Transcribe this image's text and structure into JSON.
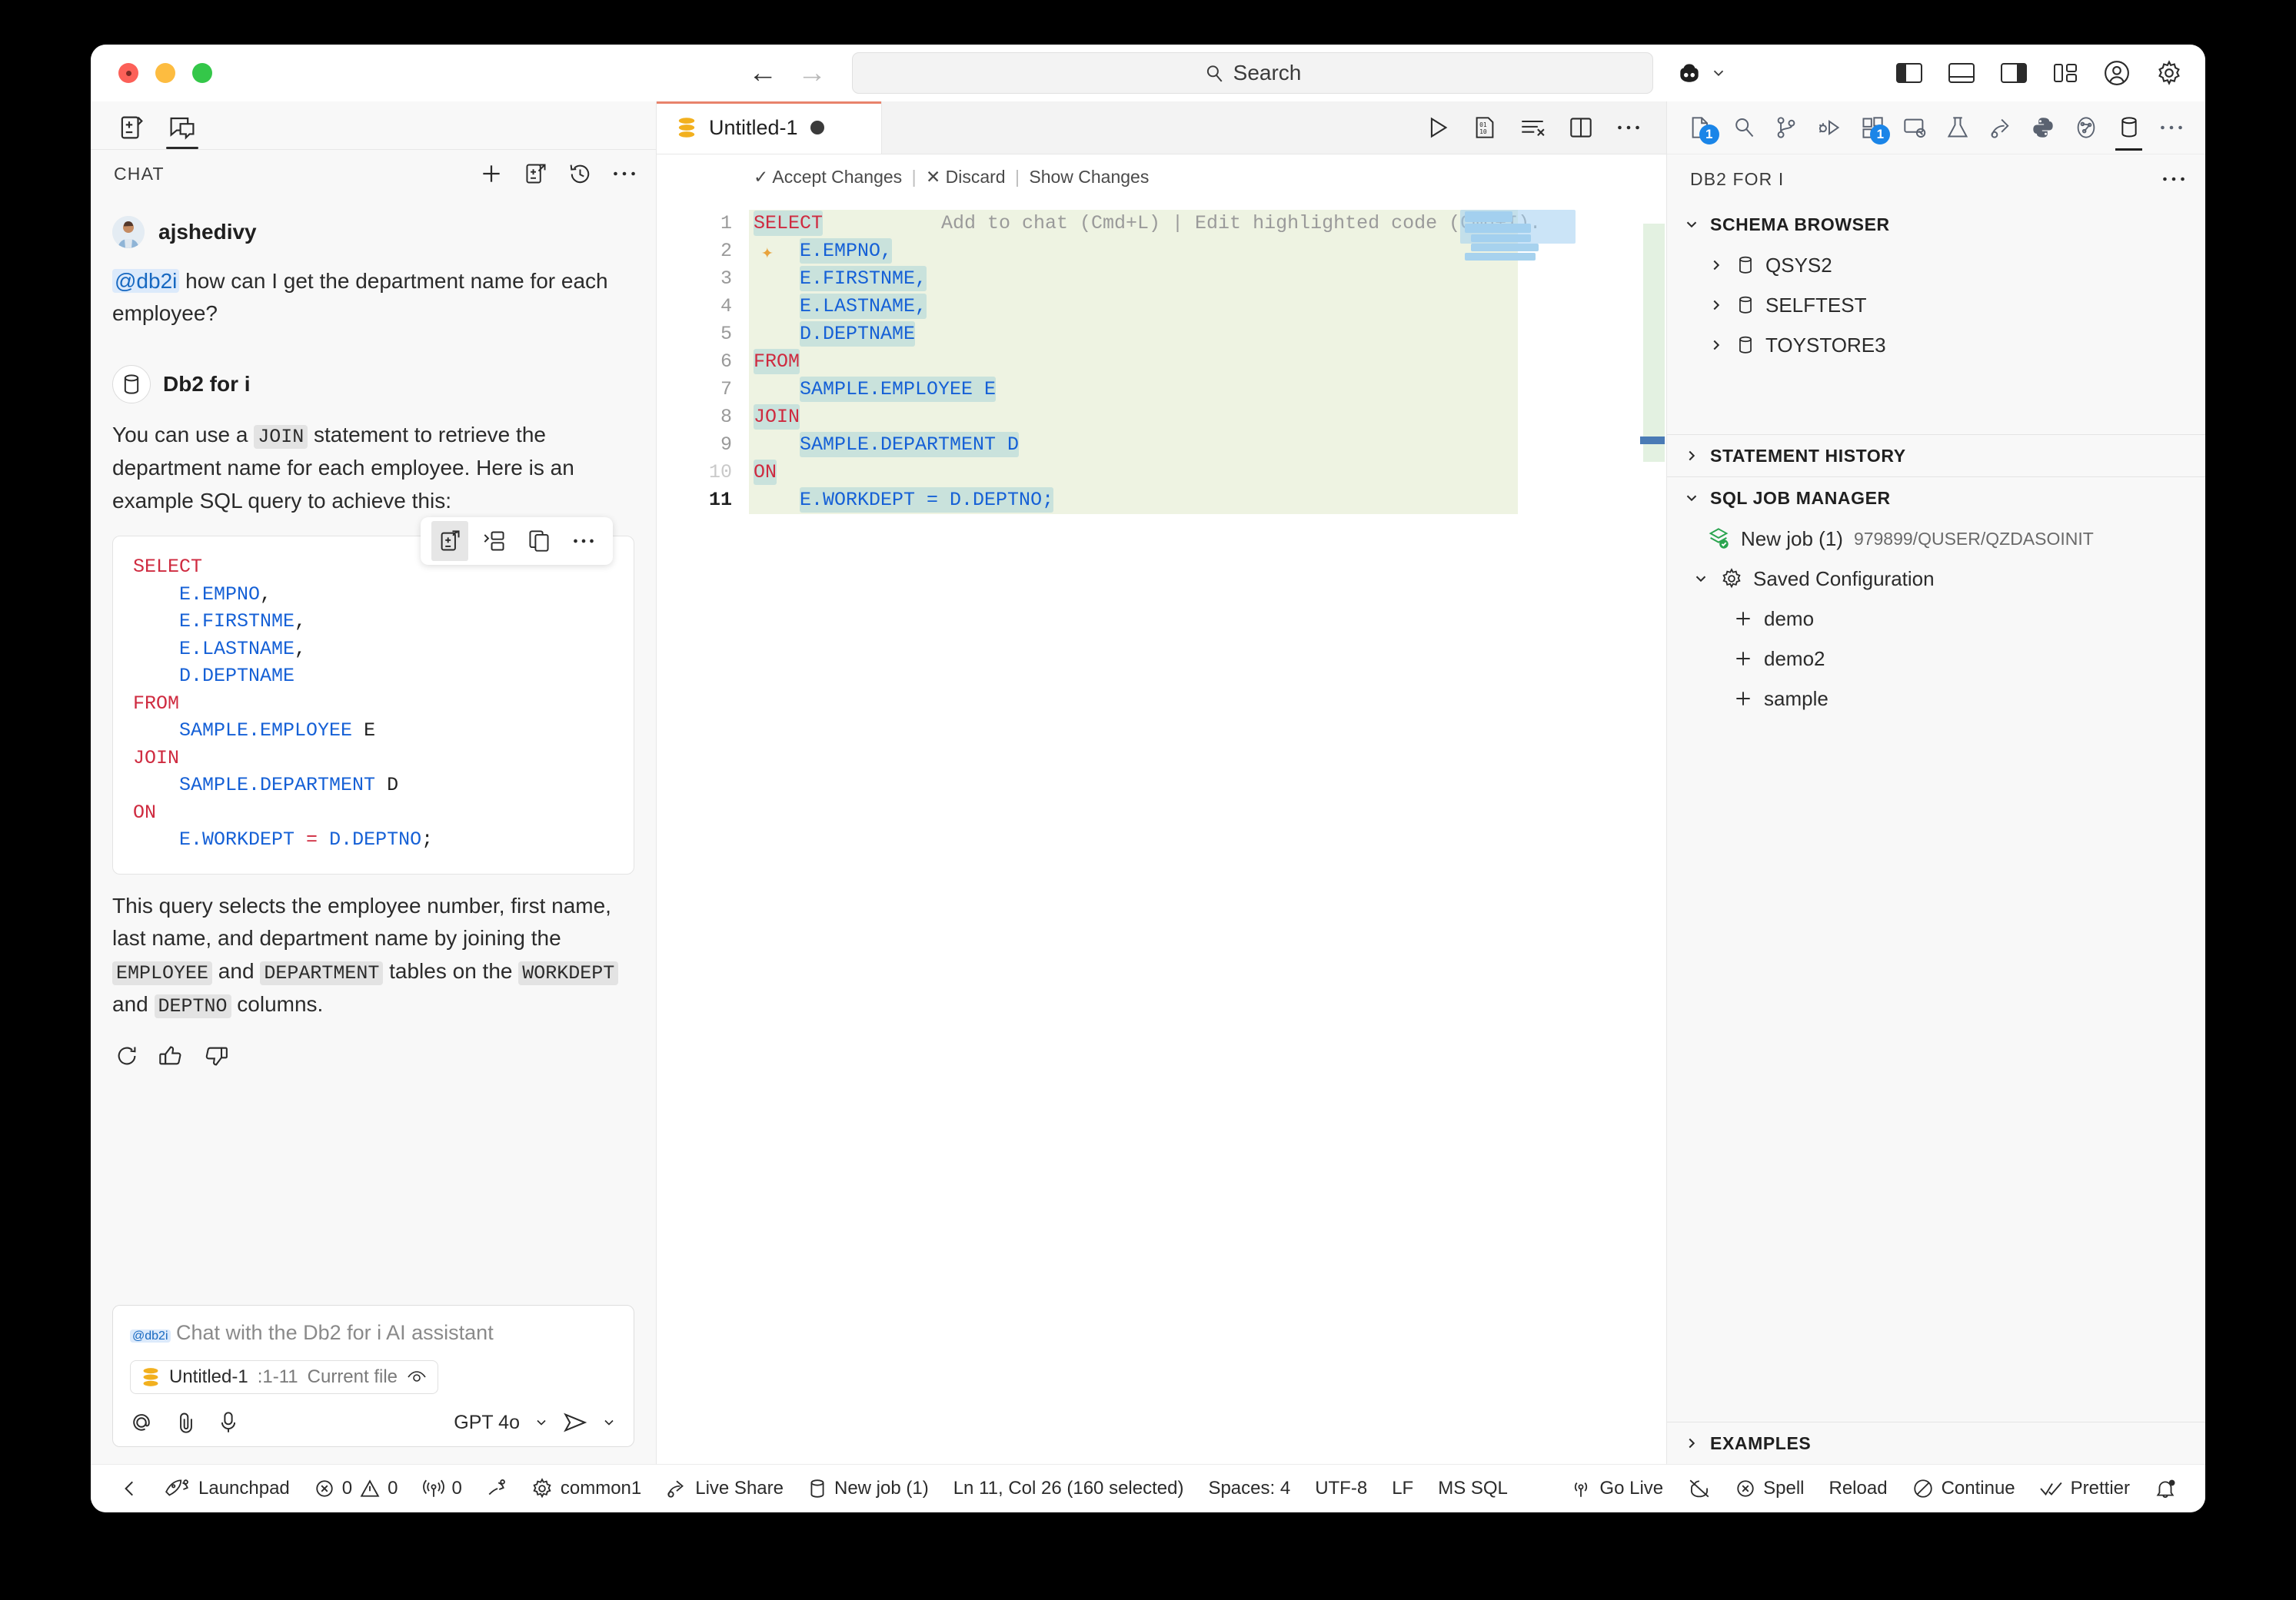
{
  "titlebar": {
    "search_placeholder": "Search",
    "icons": [
      "back-arrow",
      "forward-arrow",
      "search-icon",
      "copilot-icon",
      "chevron-down-icon",
      "layout-sidebar-left-icon",
      "layout-panel-icon",
      "layout-sidebar-right-icon",
      "layout-customize-icon",
      "account-icon",
      "gear-icon"
    ]
  },
  "chat_panel": {
    "tabs": [
      "source-control-tab",
      "chat-tab"
    ],
    "title": "CHAT",
    "actions": [
      "new-chat-icon",
      "open-editor-icon",
      "history-icon",
      "more-icon"
    ],
    "user": {
      "name": "ajshedivy",
      "mention": "@db2i",
      "question": " how can I get the department name for each employee?"
    },
    "bot": {
      "name": "Db2 for i",
      "intro_pre": "You can use a ",
      "intro_code": "JOIN",
      "intro_post": " statement to retrieve the department name for each employee. Here is an example SQL query to achieve this:",
      "code_toolbar": [
        "apply-to-editor-icon",
        "insert-at-cursor-icon",
        "copy-icon",
        "more-icon"
      ],
      "code_lines": [
        [
          {
            "t": "SELECT",
            "c": "kw"
          }
        ],
        [
          {
            "t": "    ",
            "c": "plain"
          },
          {
            "t": "E.EMPNO",
            "c": "ident"
          },
          {
            "t": ",",
            "c": "plain"
          }
        ],
        [
          {
            "t": "    ",
            "c": "plain"
          },
          {
            "t": "E.FIRSTNME",
            "c": "ident"
          },
          {
            "t": ",",
            "c": "plain"
          }
        ],
        [
          {
            "t": "    ",
            "c": "plain"
          },
          {
            "t": "E.LASTNAME",
            "c": "ident"
          },
          {
            "t": ",",
            "c": "plain"
          }
        ],
        [
          {
            "t": "    ",
            "c": "plain"
          },
          {
            "t": "D.DEPTNAME",
            "c": "ident"
          }
        ],
        [
          {
            "t": "FROM",
            "c": "kw"
          }
        ],
        [
          {
            "t": "    ",
            "c": "plain"
          },
          {
            "t": "SAMPLE.EMPLOYEE",
            "c": "ident"
          },
          {
            "t": " E",
            "c": "plain"
          }
        ],
        [
          {
            "t": "JOIN",
            "c": "kw"
          }
        ],
        [
          {
            "t": "    ",
            "c": "plain"
          },
          {
            "t": "SAMPLE.DEPARTMENT",
            "c": "ident"
          },
          {
            "t": " D",
            "c": "plain"
          }
        ],
        [
          {
            "t": "ON",
            "c": "kw"
          }
        ],
        [
          {
            "t": "    ",
            "c": "plain"
          },
          {
            "t": "E.WORKDEPT",
            "c": "ident"
          },
          {
            "t": " = ",
            "c": "op"
          },
          {
            "t": "D.DEPTNO",
            "c": "ident"
          },
          {
            "t": ";",
            "c": "plain"
          }
        ]
      ],
      "explain_1": "This query selects the employee number, first name, last name, and department name by joining the ",
      "explain_code_1": "EMPLOYEE",
      "explain_2": " and ",
      "explain_code_2": "DEPARTMENT",
      "explain_3": " tables on the ",
      "explain_code_3": "WORKDEPT",
      "explain_4": " and ",
      "explain_code_4": "DEPTNO",
      "explain_5": " columns.",
      "feedback_icons": [
        "regenerate-icon",
        "thumbs-up-icon",
        "thumbs-down-icon"
      ]
    },
    "input": {
      "mention": "@db2i",
      "placeholder": " Chat with the Db2 for i AI assistant",
      "context_file": "Untitled-1",
      "context_range": ":1-11",
      "context_label": "Current file",
      "context_eye_icon": "eye-icon",
      "left_icons": [
        "mention-icon",
        "attach-icon",
        "microphone-icon"
      ],
      "model": "GPT 4o",
      "send_icon": "send-icon"
    }
  },
  "editor": {
    "tab": {
      "title": "Untitled-1",
      "icon": "db2-file-icon",
      "dirty": true
    },
    "tab_actions": [
      "run-icon",
      "run-binary-icon",
      "format-clear-icon",
      "split-editor-icon",
      "more-icon"
    ],
    "inline_bar": {
      "accept": "Accept Changes",
      "discard": "Discard",
      "show": "Show Changes",
      "accept_icon": "check-icon",
      "discard_icon": "close-icon"
    },
    "ghost_hint": "Add to chat (Cmd+L) | Edit highlighted code (Cmd+I).",
    "line_numbers": [
      "1",
      "2",
      "3",
      "4",
      "5",
      "6",
      "7",
      "8",
      "9",
      "10",
      "11"
    ],
    "current_line": 11,
    "dim_lines": [
      10
    ],
    "code_lines": [
      [
        {
          "t": "SELECT",
          "c": "kw",
          "sel": true
        }
      ],
      [
        {
          "t": "    ",
          "c": "plain"
        },
        {
          "t": "E.EMPNO,",
          "c": "ident",
          "sel": true
        }
      ],
      [
        {
          "t": "    ",
          "c": "plain"
        },
        {
          "t": "E.FIRSTNME,",
          "c": "ident",
          "sel": true
        }
      ],
      [
        {
          "t": "    ",
          "c": "plain"
        },
        {
          "t": "E.LASTNAME,",
          "c": "ident",
          "sel": true
        }
      ],
      [
        {
          "t": "    ",
          "c": "plain"
        },
        {
          "t": "D.DEPTNAME",
          "c": "ident",
          "sel": true
        }
      ],
      [
        {
          "t": "FROM",
          "c": "kw",
          "sel": true
        }
      ],
      [
        {
          "t": "    ",
          "c": "plain"
        },
        {
          "t": "SAMPLE.EMPLOYEE E",
          "c": "ident",
          "sel": true
        }
      ],
      [
        {
          "t": "JOIN",
          "c": "kw",
          "sel": true
        }
      ],
      [
        {
          "t": "    ",
          "c": "plain"
        },
        {
          "t": "SAMPLE.DEPARTMENT D",
          "c": "ident",
          "sel": true
        }
      ],
      [
        {
          "t": "ON",
          "c": "kw",
          "sel": true
        }
      ],
      [
        {
          "t": "    ",
          "c": "plain"
        },
        {
          "t": "E.WORKDEPT = D.DEPTNO;",
          "c": "ident",
          "sel": true
        }
      ]
    ]
  },
  "right_sidebar": {
    "activity_icons": [
      {
        "name": "explorer-icon",
        "badge": "1"
      },
      {
        "name": "search-icon",
        "badge": null
      },
      {
        "name": "source-control-icon",
        "badge": null
      },
      {
        "name": "run-debug-icon",
        "badge": null
      },
      {
        "name": "extensions-icon",
        "badge": "1"
      },
      {
        "name": "remote-explorer-icon",
        "badge": null
      },
      {
        "name": "testing-icon",
        "badge": null
      },
      {
        "name": "live-share-icon",
        "badge": null
      },
      {
        "name": "python-icon",
        "badge": null
      },
      {
        "name": "graph-icon",
        "badge": null
      },
      {
        "name": "database-icon",
        "badge": null
      },
      {
        "name": "more-icon",
        "badge": null
      }
    ],
    "title": "DB2 FOR I",
    "more_icon": "more-icon",
    "schema_browser": {
      "label": "SCHEMA BROWSER",
      "expanded": true,
      "items": [
        {
          "label": "QSYS2",
          "icon": "database-icon"
        },
        {
          "label": "SELFTEST",
          "icon": "database-icon"
        },
        {
          "label": "TOYSTORE3",
          "icon": "database-icon"
        }
      ]
    },
    "statement_history": {
      "label": "STATEMENT HISTORY",
      "expanded": false
    },
    "sql_job_manager": {
      "label": "SQL JOB MANAGER",
      "expanded": true,
      "job": {
        "label": "New job (1)",
        "detail": "979899/QUSER/QZDASOINIT",
        "icon": "job-connected-icon"
      },
      "saved_config": {
        "label": "Saved Configuration",
        "icon": "gear-icon",
        "expanded": true
      },
      "configs": [
        {
          "label": "demo",
          "icon": "plus-icon"
        },
        {
          "label": "demo2",
          "icon": "plus-icon"
        },
        {
          "label": "sample",
          "icon": "plus-icon"
        }
      ]
    },
    "examples": {
      "label": "EXAMPLES",
      "expanded": false
    }
  },
  "statusbar": {
    "left": [
      {
        "name": "remote-indicator",
        "icon": "remote-icon",
        "label": ""
      },
      {
        "name": "launchpad",
        "icon": "rocket-icon",
        "label": "Launchpad"
      },
      {
        "name": "problems",
        "icon": "error-warning-icon",
        "label": "0  0"
      },
      {
        "name": "ports",
        "icon": "radio-tower-icon",
        "label": "0"
      },
      {
        "name": "remote-alt",
        "icon": "remote-icon",
        "label": ""
      },
      {
        "name": "connection",
        "icon": "gear-icon",
        "label": "common1"
      },
      {
        "name": "live-share",
        "icon": "live-share-icon",
        "label": "Live Share"
      },
      {
        "name": "sql-job",
        "icon": "database-icon",
        "label": "New job (1)"
      },
      {
        "name": "cursor-position",
        "icon": "",
        "label": "Ln 11, Col 26 (160 selected)"
      },
      {
        "name": "indentation",
        "icon": "",
        "label": "Spaces: 4"
      },
      {
        "name": "encoding",
        "icon": "",
        "label": "UTF-8"
      },
      {
        "name": "eol",
        "icon": "",
        "label": "LF"
      },
      {
        "name": "language-mode",
        "icon": "",
        "label": "MS SQL"
      }
    ],
    "right": [
      {
        "name": "go-live",
        "icon": "broadcast-icon",
        "label": "Go Live"
      },
      {
        "name": "copilot-status",
        "icon": "copilot-disabled-icon",
        "label": ""
      },
      {
        "name": "spell",
        "icon": "error-icon",
        "label": "Spell"
      },
      {
        "name": "reload",
        "icon": "",
        "label": "Reload"
      },
      {
        "name": "continue",
        "icon": "circle-slash-icon",
        "label": "Continue"
      },
      {
        "name": "prettier",
        "icon": "check-all-icon",
        "label": "Prettier"
      },
      {
        "name": "notifications",
        "icon": "bell-dot-icon",
        "label": ""
      }
    ]
  }
}
